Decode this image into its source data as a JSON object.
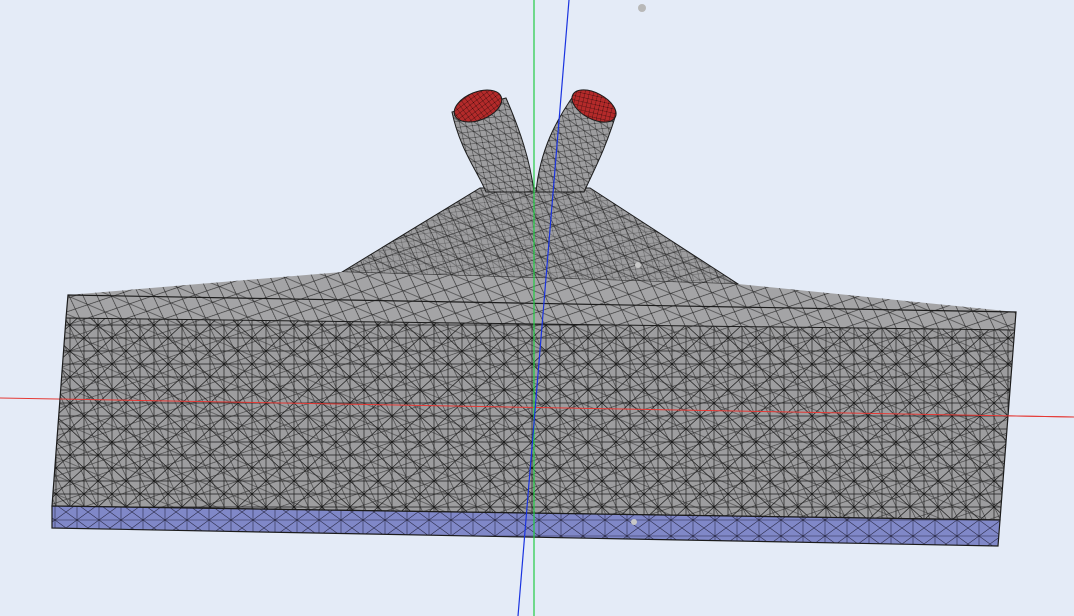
{
  "viewport": {
    "background_color": "#e4ebf7",
    "mesh_fill_color": "#9d9d9f",
    "mesh_wire_color": "#1c1c1c",
    "bottom_face_color": "#8088c8",
    "outlet_color": "#b42a2a",
    "axis_x_color": "#e53935",
    "axis_y_color": "#22cc44",
    "axis_z_color": "#1a33e0",
    "marker_color": "#b8b8b8"
  }
}
